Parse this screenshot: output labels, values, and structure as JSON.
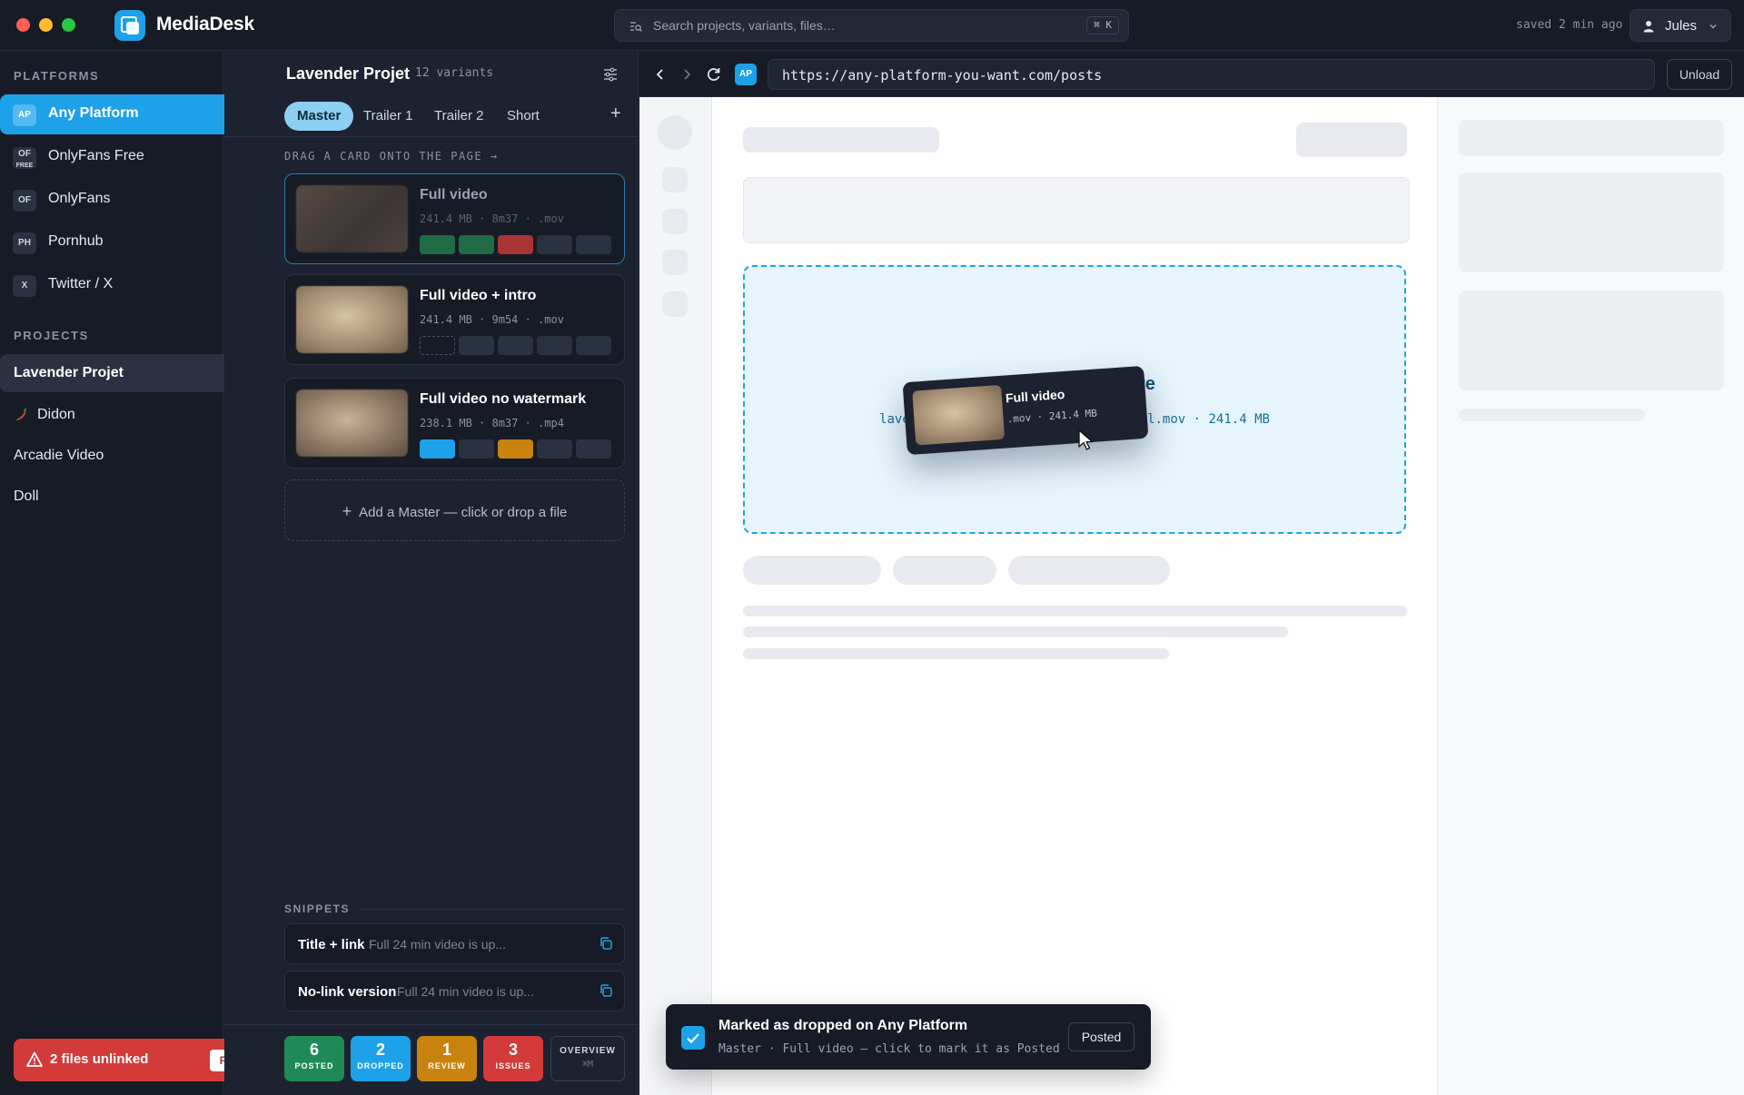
{
  "app": {
    "name": "MediaDesk",
    "search_placeholder": "Search projects, variants, files…",
    "search_shortcut": "⌘ K",
    "saved_status": "saved 2 min ago",
    "user_name": "Jules"
  },
  "sidebar": {
    "platforms_heading": "PLATFORMS",
    "platforms": [
      {
        "badge": "AP",
        "label": "Any Platform",
        "dot_color": "#ffffff"
      },
      {
        "badge": "OF",
        "label": "OnlyFans Free"
      },
      {
        "badge": "OF",
        "label": "OnlyFans",
        "dot_color": "#e0534f"
      },
      {
        "badge": "PH",
        "label": "Pornhub",
        "dot_color": "#f0a930"
      },
      {
        "badge": "X",
        "label": "Twitter / X"
      }
    ],
    "projects_heading": "PROJECTS",
    "projects": [
      {
        "label": "Lavender Projet"
      },
      {
        "label": "Didon"
      },
      {
        "label": "Arcadie Video"
      },
      {
        "label": "Doll"
      }
    ],
    "alert": {
      "label": "2 files unlinked",
      "action": "FIX"
    }
  },
  "variants_panel": {
    "project_title": "Lavender Projet",
    "variant_count": "12 variants",
    "tabs": [
      "Master",
      "Trailer 1",
      "Trailer 2",
      "Short"
    ],
    "drag_hint": "DRAG A CARD ONTO THE PAGE →",
    "cards": [
      {
        "title": "Full video",
        "meta": "241.4 MB · 8m37 · .mov"
      },
      {
        "title": "Full video + intro",
        "meta": "241.4 MB · 9m54 · .mov"
      },
      {
        "title": "Full video no watermark",
        "meta": "238.1 MB · 8m37 · .mp4"
      }
    ],
    "add_master": "Add a Master — click or drop a file",
    "snippets_heading": "SNIPPETS",
    "snippets": [
      {
        "title": "Title + link",
        "text": "Full 24 min video is up..."
      },
      {
        "title": "No-link version",
        "text": "Full 24 min video is up..."
      }
    ],
    "stats": [
      {
        "num": "6",
        "label": "POSTED",
        "color": "#1f8a55"
      },
      {
        "num": "2",
        "label": "DROPPED",
        "color": "#1da1e8"
      },
      {
        "num": "1",
        "label": "REVIEW",
        "color": "#c8830e"
      },
      {
        "num": "3",
        "label": "ISSUES",
        "color": "#d33a3a"
      }
    ],
    "overview": {
      "label": "OVERVIEW",
      "shortcut": "⌘M"
    }
  },
  "browser": {
    "badge": "AP",
    "url": "https://any-platform-you-want.com/posts",
    "unload_label": "Unload",
    "dropzone_title": "Drop your file here",
    "dropzone_file": "lavender-project-full-intro-v3-final.mov · 241.4 MB",
    "drag_ghost_title": "Full video",
    "drag_ghost_meta": ".mov · 241.4 MB"
  },
  "toast": {
    "title": "Marked as dropped on Any Platform",
    "subtitle": "Master · Full video — click to mark it as Posted",
    "action": "Posted"
  },
  "colors": {
    "accent": "#1da1e8",
    "posted": "#1f8a55",
    "issue": "#d33a3a",
    "review": "#c8830e"
  }
}
